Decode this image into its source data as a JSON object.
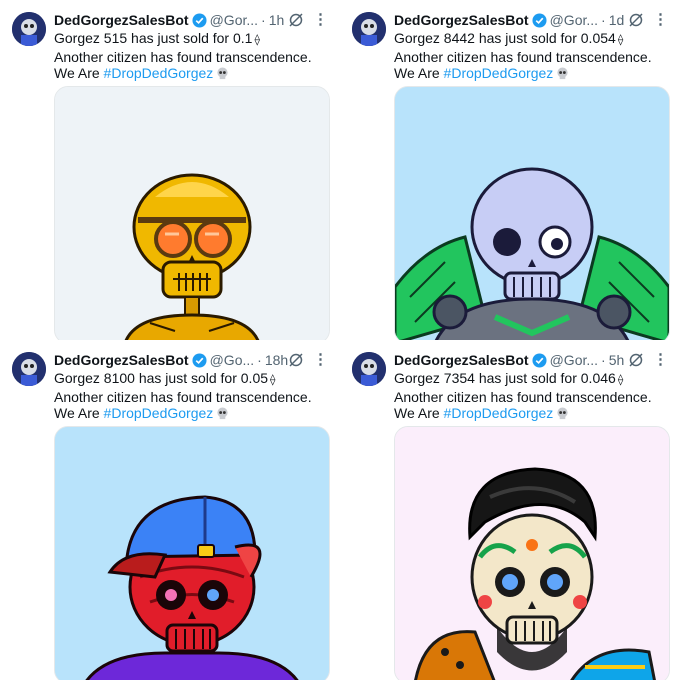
{
  "tweets": [
    {
      "name": "DedGorgezSalesBot",
      "handle": "@Gor...",
      "time": "1h",
      "line1": "Gorgez 515 has just sold for 0.1",
      "line2": "Another citizen has found transcendence.",
      "we_are": "We Are",
      "hashtag": "#DropDedGorgez",
      "eth_symbol": "⟠",
      "image_bg": "#eef3f7",
      "icons": [
        "verified-icon",
        "grok-icon",
        "more-icon",
        "skull-icon"
      ]
    },
    {
      "name": "DedGorgezSalesBot",
      "handle": "@Gor...",
      "time": "1d",
      "line1": "Gorgez 8442 has just sold for 0.054",
      "line2": "Another citizen has found transcendence.",
      "we_are": "We Are",
      "hashtag": "#DropDedGorgez",
      "eth_symbol": "⟠",
      "image_bg": "#b8e3fb"
    },
    {
      "name": "DedGorgezSalesBot",
      "handle": "@Go...",
      "time": "18h",
      "line1": "Gorgez 8100 has just sold for 0.05",
      "line2": "Another citizen has found transcendence.",
      "we_are": "We Are",
      "hashtag": "#DropDedGorgez",
      "eth_symbol": "⟠",
      "image_bg": "#b8e3fb"
    },
    {
      "name": "DedGorgezSalesBot",
      "handle": "@Gor...",
      "time": "5h",
      "line1": "Gorgez 7354 has just sold for 0.046",
      "line2": "Another citizen has found transcendence.",
      "we_are": "We Are",
      "hashtag": "#DropDedGorgez",
      "eth_symbol": "⟠",
      "image_bg": "#fbeefb"
    }
  ],
  "separator": "·",
  "more_glyph": "⋮",
  "colors": {
    "link": "#1d9bf0",
    "muted": "#536471",
    "verified": "#1d9bf0"
  }
}
